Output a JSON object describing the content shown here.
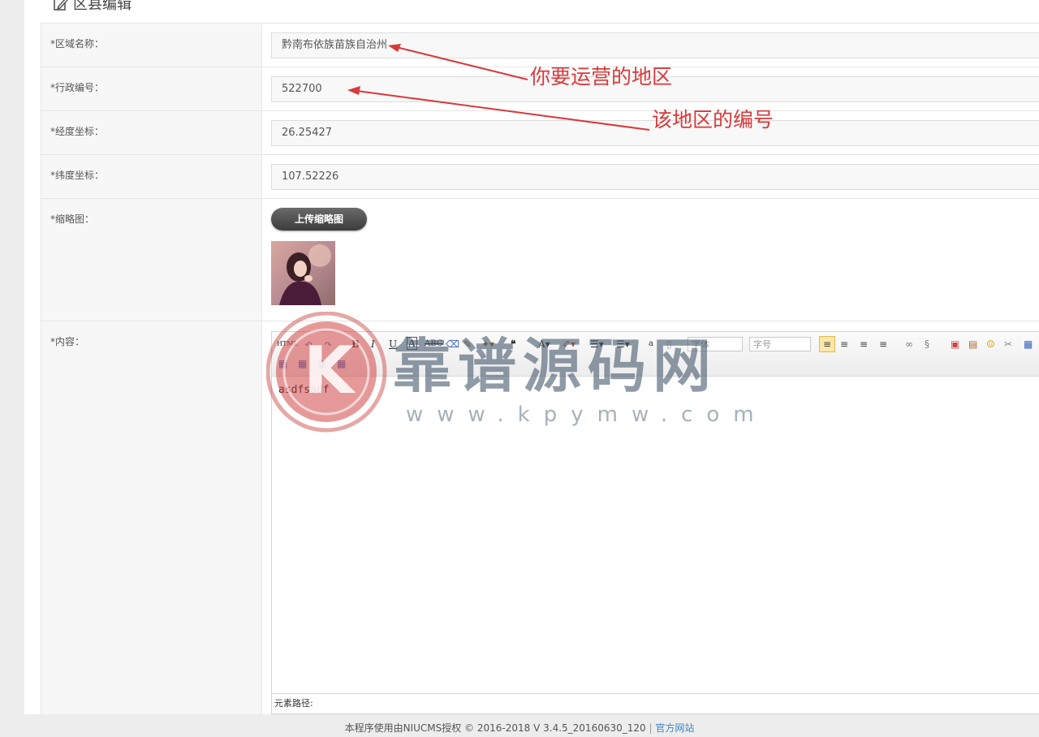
{
  "header": {
    "title": "区县编辑",
    "icon": "edit-icon"
  },
  "form": {
    "region_name": {
      "label": "*区域名称：",
      "value": "黔南布依族苗族自治州"
    },
    "admin_code": {
      "label": "*行政编号：",
      "value": "522700"
    },
    "longitude": {
      "label": "*经度坐标：",
      "value": "26.25427"
    },
    "latitude": {
      "label": "*纬度坐标：",
      "value": "107.52226"
    },
    "thumbnail": {
      "label": "*缩略图：",
      "upload_label": "上传缩略图"
    },
    "content": {
      "label": "*内容：",
      "value": "asdfsadf"
    }
  },
  "editor": {
    "font_family_placeholder": "字体",
    "font_size_placeholder": "字号",
    "element_path_label": "元素路径:"
  },
  "annotations": {
    "region": "你要运营的地区",
    "code": "该地区的编号"
  },
  "watermark": {
    "title": "靠谱源码网",
    "url": "www.kpymw.com",
    "logo_letter": "K"
  },
  "footer": {
    "text": "本程序使用由NIUCMS授权 © 2016-2018 V 3.4.5_20160630_120",
    "separator": "|",
    "link_label": "官方网站"
  },
  "colors": {
    "annotation": "#d9393a",
    "link": "#3a87c8",
    "button": "#4a4a4a"
  }
}
